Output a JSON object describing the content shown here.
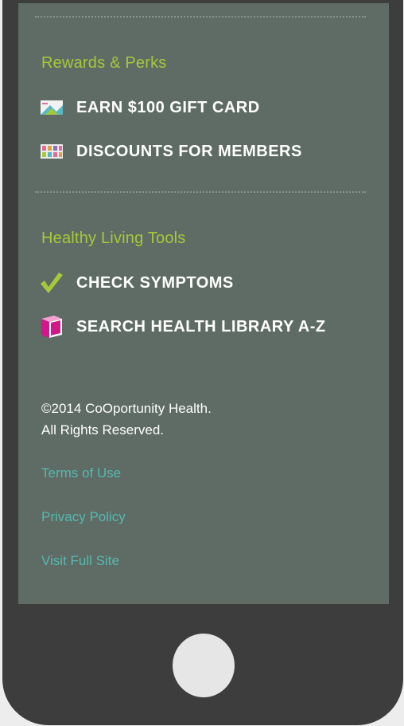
{
  "rewards": {
    "title": "Rewards & Perks",
    "items": [
      {
        "label": "EARN $100 GIFT CARD",
        "icon": "gift-card-icon"
      },
      {
        "label": "DISCOUNTS FOR MEMBERS",
        "icon": "discount-cards-icon"
      }
    ]
  },
  "tools": {
    "title": "Healthy Living Tools",
    "items": [
      {
        "label": "CHECK SYMPTOMS",
        "icon": "checkmark-icon"
      },
      {
        "label": "SEARCH HEALTH LIBRARY A-Z",
        "icon": "book-icon"
      }
    ]
  },
  "footer": {
    "copyright_line1": "©2014 CoOportunity Health.",
    "copyright_line2": "All Rights Reserved.",
    "links": [
      "Terms of Use",
      "Privacy Policy",
      "Visit Full Site"
    ]
  },
  "colors": {
    "screen_bg": "#5f6c65",
    "heading": "#a5c93a",
    "link": "#54b9b0",
    "device": "#3d3d3d",
    "book_icon": "#d1178a"
  }
}
